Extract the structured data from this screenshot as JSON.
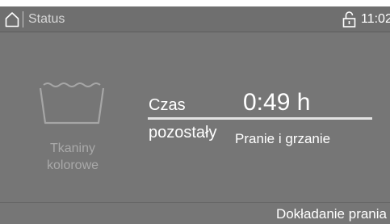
{
  "status_bar": {
    "title": "Status",
    "time": "11:02",
    "home_icon": "home-icon",
    "lock_icon": "lock-open-icon"
  },
  "program": {
    "icon": "wash-tub-icon",
    "name": "Tkaniny kolorowe"
  },
  "remaining": {
    "label_line1": "Czas",
    "label_line2": "pozostały",
    "value": "0:49 h"
  },
  "phase": {
    "text": "Pranie i grzanie"
  },
  "bottom_bar": {
    "action_label": "Dokładanie prania"
  },
  "colors": {
    "background": "#767676",
    "text_primary": "#ffffff",
    "text_muted": "#a9a9a9"
  }
}
